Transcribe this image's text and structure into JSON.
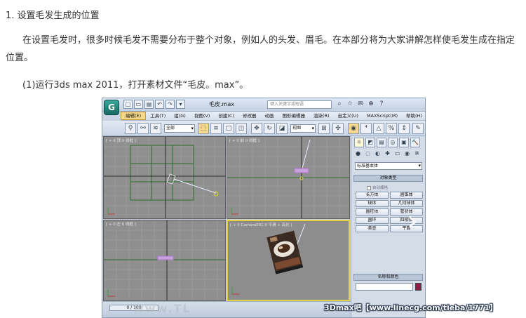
{
  "article": {
    "heading": "1. 设置毛发生成的位置",
    "paragraph": "在设置毛发时，很多时候毛发不需要分布于整个对象，例如人的头发、眉毛。在本部分将为大家讲解怎样使毛发生成在指定位置。",
    "step": "(1)运行3ds max 2011，打开素材文件“毛皮。max”。"
  },
  "screenshot": {
    "app_logo": "G",
    "quick_access": [
      "□",
      "▭",
      "▤",
      "↶",
      "↷",
      "▾"
    ],
    "document_title": "毛皮.max",
    "search_placeholder": "键入关键字或短语",
    "title_icons": [
      "⌕",
      "☆",
      "✉",
      "⊕",
      "?"
    ],
    "menu": [
      "编辑(E)",
      "工具(T)",
      "组(G)",
      "视图(V)",
      "创建(C)",
      "修改器",
      "动画",
      "图形编辑器",
      "渲染(R)",
      "自定义(U)",
      "MAXScript(M)",
      "帮助(H)"
    ],
    "active_menu_index": 0,
    "toolbar": {
      "selection_filter": "全部",
      "reference_coord": "视图"
    },
    "viewports": [
      {
        "label": "[ + 0 顶 0 线框 ]"
      },
      {
        "label": "[ + 0 前 0 线框 ]"
      },
      {
        "label": "[ + 0 左 0 线框 ]"
      },
      {
        "label": "[ + 0 Camera001 0 平滑 + 高光 ]"
      }
    ],
    "command_panel": {
      "tabs": [
        "☼",
        "◩",
        "▤",
        "◎",
        "▣",
        "🔨"
      ],
      "create_icons": [
        "●",
        "◌",
        "◐",
        "✚",
        "▭",
        "◉",
        "✲"
      ],
      "category": "标准基本体",
      "object_type_title": "对象类型",
      "autogrid": "自动栅格",
      "object_buttons": [
        "长方体",
        "圆锥体",
        "球体",
        "几何球体",
        "圆柱体",
        "管状体",
        "圆环",
        "四棱锥",
        "茶壶",
        "平面"
      ],
      "name_color_title": "名称和颜色",
      "object_color": "#8c1f4a"
    },
    "status": {
      "frame": "0 / 100"
    }
  },
  "overlay": {
    "next_arrow": "›",
    "watermark": "3Dmax吧【www.linecg.com/tieba/1771】",
    "ghost_text": "www.TL"
  }
}
